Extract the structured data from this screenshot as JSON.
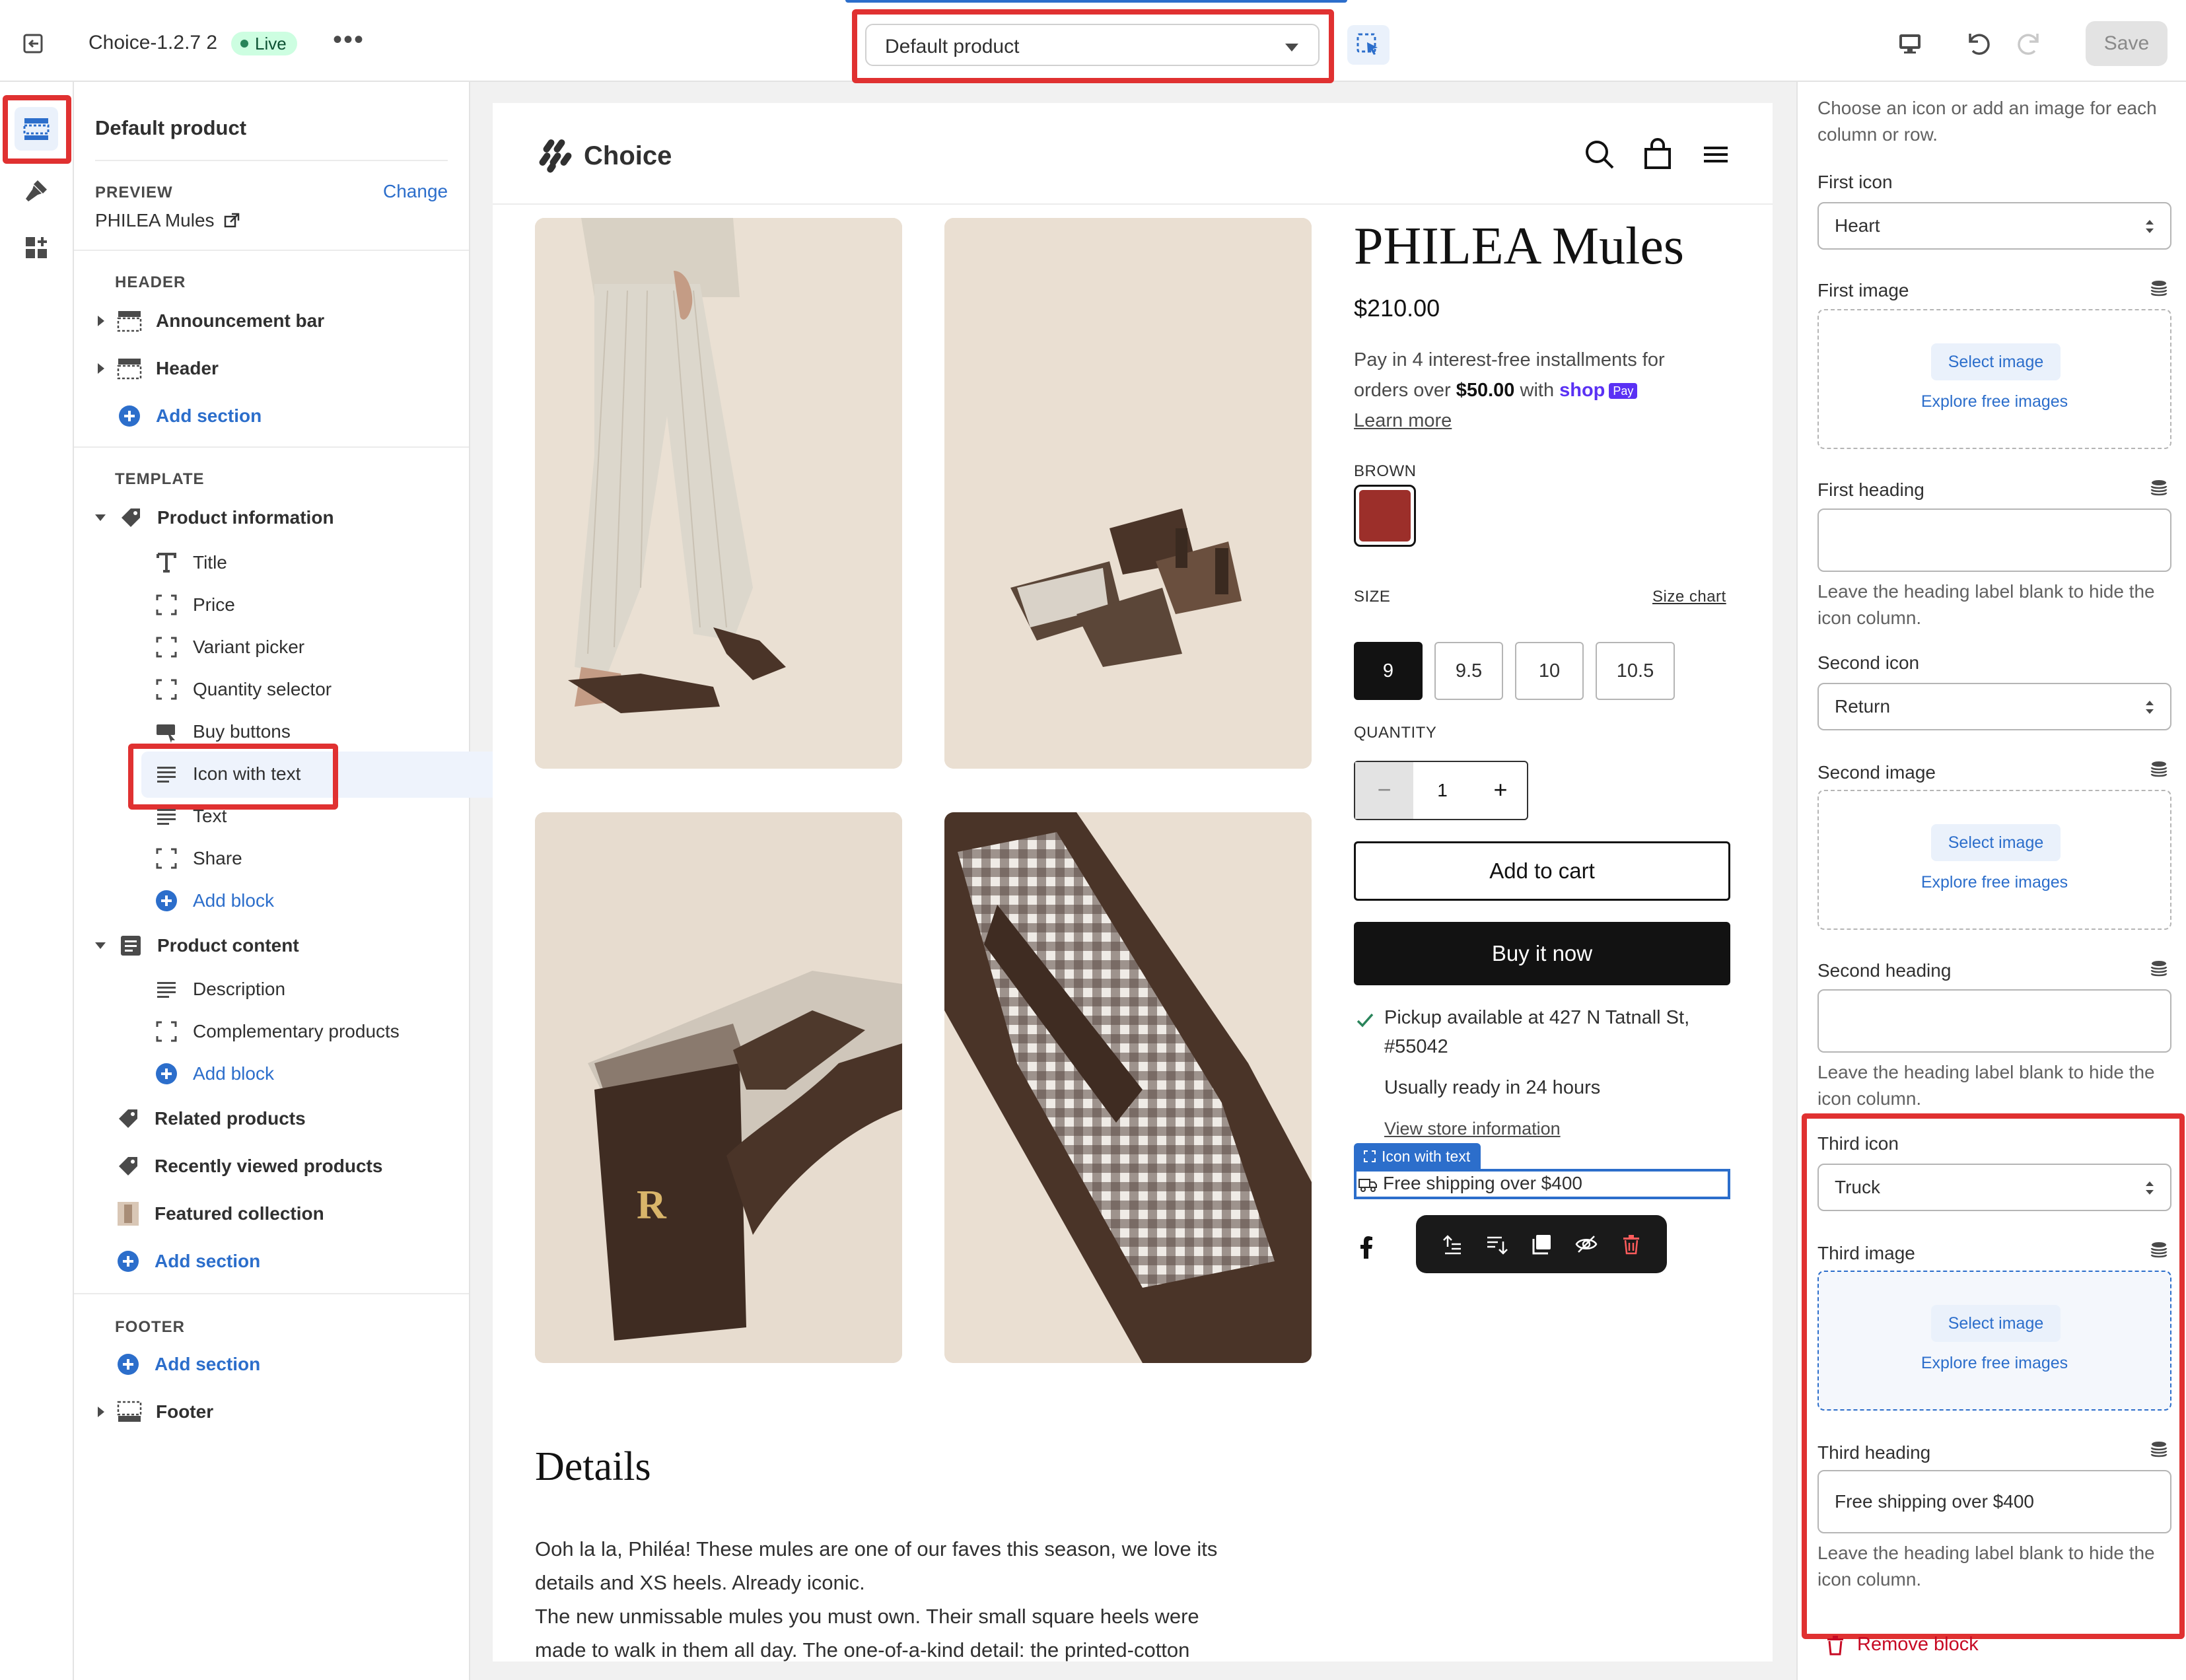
{
  "topbar": {
    "theme_name": "Choice-1.2.7 2",
    "live_badge": "Live",
    "template_select": "Default product",
    "save_label": "Save"
  },
  "left_panel": {
    "title": "Default product",
    "preview_label": "PREVIEW",
    "preview_change": "Change",
    "preview_product": "PHILEA Mules",
    "header_group": "HEADER",
    "header_items": [
      "Announcement bar",
      "Header"
    ],
    "add_section": "Add section",
    "template_group": "TEMPLATE",
    "product_information": "Product information",
    "product_information_blocks": [
      "Title",
      "Price",
      "Variant picker",
      "Quantity selector",
      "Buy buttons",
      "Icon with text",
      "Text",
      "Share"
    ],
    "add_block": "Add block",
    "product_content": "Product content",
    "product_content_blocks": [
      "Description",
      "Complementary products"
    ],
    "other_sections": [
      "Related products",
      "Recently viewed products",
      "Featured collection"
    ],
    "footer_group": "FOOTER",
    "footer_item": "Footer"
  },
  "preview": {
    "store_name": "Choice",
    "product_title": "PHILEA Mules",
    "price": "$210.00",
    "installments_line1": "Pay in 4 interest-free installments for",
    "installments_line2_a": "orders over ",
    "installments_amount": "$50.00",
    "installments_line2_b": " with ",
    "shop_pay_word": "shop",
    "shop_pay_badge": "Pay",
    "learn_more": "Learn more",
    "color_label": "BROWN",
    "size_label": "SIZE",
    "size_chart": "Size chart",
    "sizes": [
      "9",
      "9.5",
      "10",
      "10.5"
    ],
    "selected_size": "9",
    "quantity_label": "QUANTITY",
    "quantity_value": "1",
    "add_to_cart": "Add to cart",
    "buy_now": "Buy it now",
    "pickup_line1": "Pickup available at 427 N Tatnall St,",
    "pickup_line2": "#55042",
    "ready_text": "Usually ready in 24 hours",
    "store_info": "View store information",
    "iwt_tag": "Icon with text",
    "iwt_text": "Free shipping over $400",
    "photo_letter": "R",
    "details_heading": "Details",
    "description": [
      "Ooh la la, Philéa! These mules are one of our faves this season, we love its",
      "details and XS heels. Already iconic.",
      "The new unmissable mules you must own. Their small square heels were",
      "made to walk in them all day. The one-of-a-kind detail: the printed-cotton"
    ]
  },
  "right_panel": {
    "intro": "Choose an icon or add an image for each column or row.",
    "first_icon_label": "First icon",
    "first_icon_value": "Heart",
    "first_image_label": "First image",
    "first_heading_label": "First heading",
    "first_heading_value": "",
    "second_icon_label": "Second icon",
    "second_icon_value": "Return",
    "second_image_label": "Second image",
    "second_heading_label": "Second heading",
    "second_heading_value": "",
    "third_icon_label": "Third icon",
    "third_icon_value": "Truck",
    "third_image_label": "Third image",
    "third_heading_label": "Third heading",
    "third_heading_value": "Free shipping over $400",
    "select_image": "Select image",
    "explore_images": "Explore free images",
    "heading_help": "Leave the heading label blank to hide the icon column.",
    "remove_block": "Remove block"
  },
  "colors": {
    "accent": "#2c6ecb",
    "highlight_red": "#e03131",
    "swatch_brown": "#9c2f2a",
    "live_green": "#cdfee1"
  }
}
